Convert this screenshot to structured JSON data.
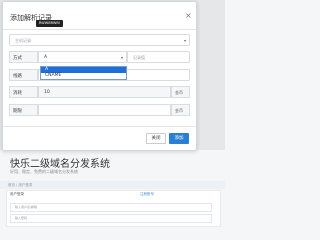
{
  "modal": {
    "title": "添加解析记录",
    "tooltip": "RWWBRWB!",
    "close_symbol": "×",
    "host_placeholder": "主机记录",
    "mode_label": "方式",
    "mode_value": "A",
    "record_placeholder": "记录值",
    "line_label": "线路",
    "cost_label": "消耗",
    "cost_value": "10",
    "cost_unit": "金币",
    "period_label": "期限",
    "period_unit": "金币",
    "dropdown_options": [
      "A",
      "CNAME"
    ],
    "dropdown_selected": "A",
    "close_button": "关闭",
    "add_button": "添加"
  },
  "page": {
    "site_title": "快乐二级域名分发系统",
    "site_subtitle": "好用、稳定、免费的二级域名分发系统",
    "breadcrumb": "首页 / 用户登录",
    "card_header_left": "用户登录",
    "card_header_right": "注册账号",
    "input1_placeholder": "输入用户名/邮箱",
    "input2_placeholder": "输入密码"
  },
  "colors": {
    "primary": "#2a7fd4",
    "selected_option": "#1e6fd9"
  }
}
